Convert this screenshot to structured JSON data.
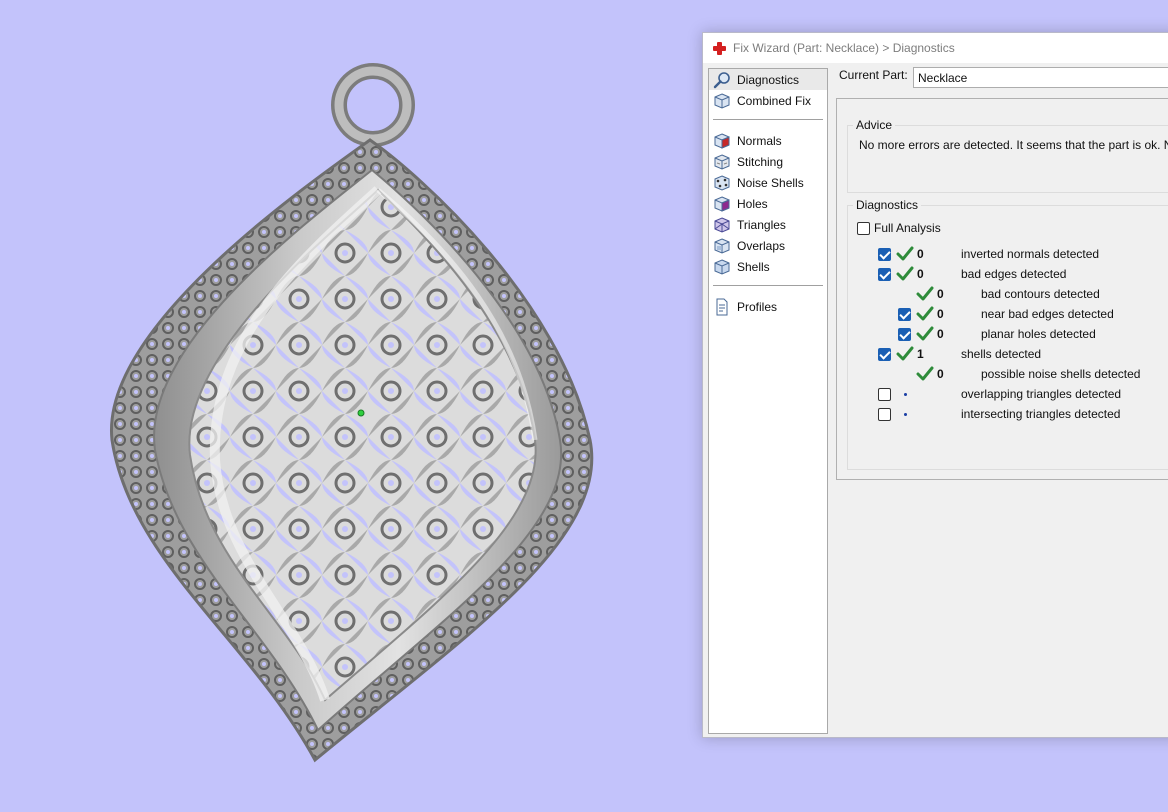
{
  "window": {
    "title": "Fix Wizard (Part: Necklace) > Diagnostics",
    "accent_color": "#d42020"
  },
  "nav": {
    "group1": [
      {
        "label": "Diagnostics",
        "icon": "magnifier-icon",
        "selected": true
      },
      {
        "label": "Combined Fix",
        "icon": "combined-fix-cube-icon",
        "selected": false
      }
    ],
    "group2": [
      {
        "label": "Normals",
        "icon": "normals-cube-icon"
      },
      {
        "label": "Stitching",
        "icon": "stitching-cube-icon"
      },
      {
        "label": "Noise Shells",
        "icon": "noise-shells-cube-icon"
      },
      {
        "label": "Holes",
        "icon": "holes-cube-icon"
      },
      {
        "label": "Triangles",
        "icon": "triangles-cube-icon"
      },
      {
        "label": "Overlaps",
        "icon": "overlaps-cube-icon"
      },
      {
        "label": "Shells",
        "icon": "shells-cube-icon"
      }
    ],
    "group3": [
      {
        "label": "Profiles",
        "icon": "profile-document-icon"
      }
    ]
  },
  "current_part": {
    "label": "Current Part:",
    "value": "Necklace"
  },
  "advice": {
    "legend": "Advice",
    "text": "No more errors are detected. It seems that the part is ok. Note t"
  },
  "diagnostics": {
    "legend": "Diagnostics",
    "full_analysis_label": "Full Analysis",
    "full_analysis_checked": false,
    "rows": [
      {
        "indent": 0,
        "checkbox": true,
        "checked": true,
        "status": "ok",
        "count": "0",
        "label": "inverted normals detected"
      },
      {
        "indent": 0,
        "checkbox": true,
        "checked": true,
        "status": "ok",
        "count": "0",
        "label": "bad edges detected"
      },
      {
        "indent": 1,
        "checkbox": false,
        "checked": false,
        "status": "ok",
        "count": "0",
        "label": "bad contours detected"
      },
      {
        "indent": 1,
        "checkbox": true,
        "checked": true,
        "status": "ok",
        "count": "0",
        "label": "near bad edges detected"
      },
      {
        "indent": 1,
        "checkbox": true,
        "checked": true,
        "status": "ok",
        "count": "0",
        "label": "planar holes detected"
      },
      {
        "indent": 0,
        "checkbox": true,
        "checked": true,
        "status": "ok",
        "count": "1",
        "label": "shells detected"
      },
      {
        "indent": 1,
        "checkbox": false,
        "checked": false,
        "status": "ok",
        "count": "0",
        "label": "possible noise shells detected"
      },
      {
        "indent": 0,
        "checkbox": true,
        "checked": false,
        "status": "pending",
        "count": "",
        "label": "overlapping triangles detected"
      },
      {
        "indent": 0,
        "checkbox": true,
        "checked": false,
        "status": "pending",
        "count": "",
        "label": "intersecting triangles detected"
      }
    ]
  },
  "colors": {
    "background": "#c3c3fb",
    "model": "#b4b4b4",
    "check_green": "#2e8b3a",
    "checkbox_blue": "#1a5fb4"
  }
}
